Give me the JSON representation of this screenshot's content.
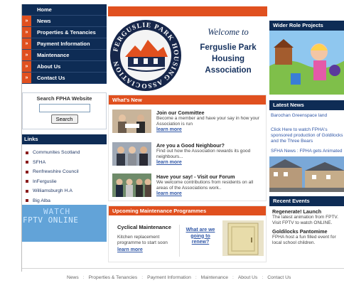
{
  "nav": {
    "items": [
      {
        "label": "Home"
      },
      {
        "label": "News"
      },
      {
        "label": "Properties & Tenancies"
      },
      {
        "label": "Payment Information"
      },
      {
        "label": "Maintenance"
      },
      {
        "label": "About Us"
      },
      {
        "label": "Contact Us"
      }
    ],
    "arrow_glyph": "»"
  },
  "search": {
    "title": "Search FPHA Website",
    "value": "",
    "button_label": "Search"
  },
  "links": {
    "title": "Links",
    "items": [
      "Communites Scotland",
      "SFHA",
      "Renfrewshire Council",
      "InFerguslie",
      "Williamsburgh H.A",
      "Big Alba"
    ]
  },
  "fptv_banner": {
    "line1": "WATCH",
    "line2": "FPTV ONLINE"
  },
  "logo": {
    "ring_text": "FERGUSLIE PARK HOUSING ASSOCIATION LIMITED"
  },
  "welcome": {
    "line1": "Welcome to",
    "line2": "Ferguslie Park",
    "line3": "Housing",
    "line4": "Association"
  },
  "wider_role": {
    "title": "Wider Role Projects"
  },
  "latest_news": {
    "title": "Latest News",
    "items": [
      "Barochan Greenspace land",
      "Click Here to watch FPHA's sponsored production of Goldilocks and the Three Bears",
      "SFHA News : FPHA gets Animated"
    ]
  },
  "recent_events": {
    "title": "Recent Events",
    "items": [
      {
        "title": "Regenerate! Launch",
        "desc": "The latest animation from FPTV. Visit FPTV to watch ONLINE."
      },
      {
        "title": "Goldilocks Pantomime",
        "desc": "FPHA host a fun filled event for local school children."
      }
    ]
  },
  "whats_new": {
    "title": "What's New",
    "items": [
      {
        "title": "Join our Committee",
        "desc": "Become a member and have your say in how your Association is run",
        "more": "learn more"
      },
      {
        "title": "Are you a Good Neighbour?",
        "desc": "Find out how the Association rewards its good neighbours...",
        "more": "learn more"
      },
      {
        "title": "Have your say! - Visit our Forum",
        "desc": "We welcome contributions from residents on all areas of the Associations work..",
        "more": "learn more"
      }
    ]
  },
  "maintenance": {
    "title": "Upcoming Maintenance Programmes",
    "item_title": "Cyclical Maintenance",
    "item_desc": "Kitchen replacement programme to start soon",
    "more": "learn more",
    "question": "What are we going to renew?"
  },
  "footer": {
    "items": [
      "News",
      "Properties & Tenancies",
      "Payment Information",
      "Maintenance",
      "About Us",
      "Contact Us"
    ],
    "separator": ":"
  },
  "colors": {
    "navy": "#0e2c55",
    "orange": "#e0501f",
    "link_blue": "#2f56a6"
  }
}
